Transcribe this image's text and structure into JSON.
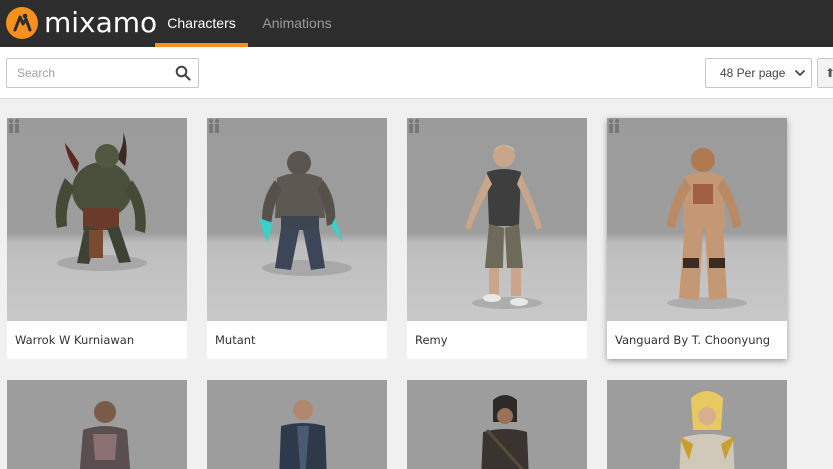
{
  "header": {
    "brand": "mixamo",
    "tabs": [
      {
        "label": "Characters",
        "active": true
      },
      {
        "label": "Animations",
        "active": false
      }
    ]
  },
  "toolbar": {
    "search_placeholder": "Search",
    "per_page": "48 Per page"
  },
  "characters": [
    {
      "name": "Warrok W Kurniawan"
    },
    {
      "name": "Mutant"
    },
    {
      "name": "Remy"
    },
    {
      "name": "Vanguard By T. Choonyung"
    }
  ],
  "colors": {
    "accent": "#f7901e",
    "header_bg": "#2d2d2d",
    "page_bg": "#f0f0f0"
  }
}
